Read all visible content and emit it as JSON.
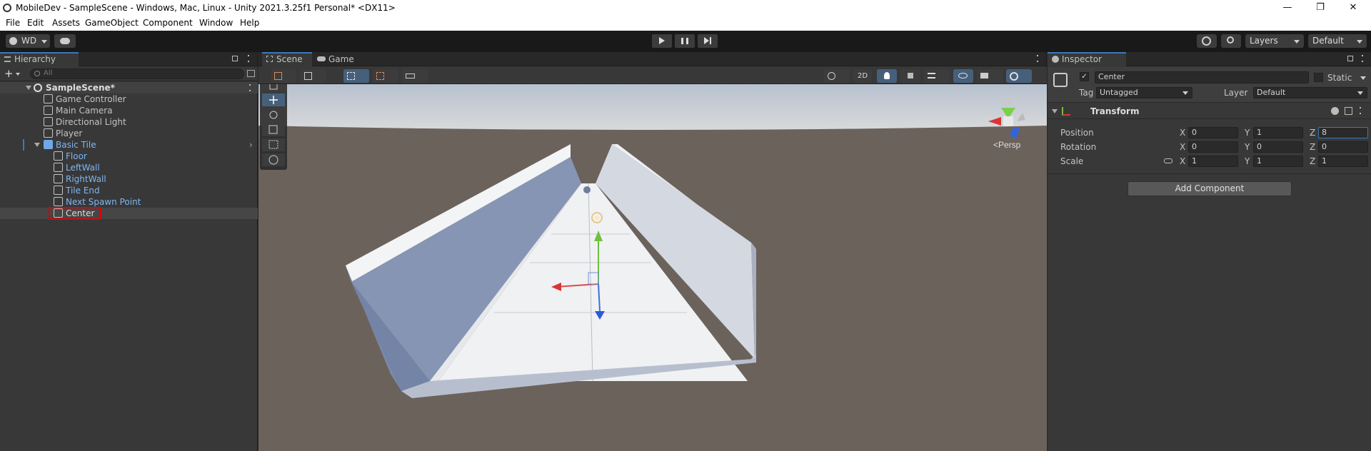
{
  "window": {
    "title": "MobileDev - SampleScene - Windows, Mac, Linux - Unity 2021.3.25f1 Personal* <DX11>",
    "minimize": "—",
    "maximize": "❐",
    "close": "✕"
  },
  "menu": [
    "File",
    "Edit",
    "Assets",
    "GameObject",
    "Component",
    "Window",
    "Help"
  ],
  "toolbar": {
    "account": "WD",
    "layers": "Layers",
    "layout": "Default"
  },
  "hierarchy": {
    "tab": "Hierarchy",
    "search_placeholder": "All",
    "scene": "SampleScene*",
    "items": [
      "Game Controller",
      "Main Camera",
      "Directional Light",
      "Player",
      "Basic Tile",
      "Floor",
      "LeftWall",
      "RightWall",
      "Tile End",
      "Next Spawn Point",
      "Center"
    ]
  },
  "scene": {
    "tabs": [
      "Scene",
      "Game"
    ],
    "mode_2d": "2D",
    "persp_label": "<Persp"
  },
  "inspector": {
    "tab": "Inspector",
    "object_name": "Center",
    "static_label": "Static",
    "tag_label": "Tag",
    "tag_value": "Untagged",
    "layer_label": "Layer",
    "layer_value": "Default",
    "component": "Transform",
    "rows": [
      {
        "label": "Position",
        "x": "0",
        "y": "1",
        "z": "8"
      },
      {
        "label": "Rotation",
        "x": "0",
        "y": "0",
        "z": "0"
      },
      {
        "label": "Scale",
        "x": "1",
        "y": "1",
        "z": "1"
      }
    ],
    "axis": {
      "x": "X",
      "y": "Y",
      "z": "Z"
    },
    "add_component": "Add Component"
  },
  "colors": {
    "accent": "#3a79bb",
    "selection_highlight": "#e00000",
    "prefab_blue": "#7fb6f5",
    "sky": "#c8d1dd",
    "ground": "#5e554f"
  }
}
